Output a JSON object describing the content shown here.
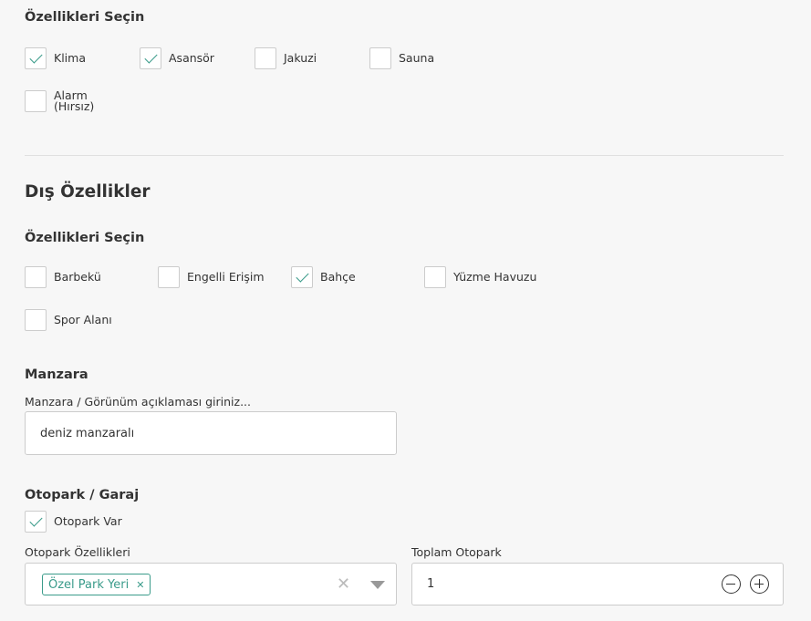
{
  "interior": {
    "section_title": "Özellikleri Seçin",
    "options": [
      {
        "label": "Klima",
        "checked": true
      },
      {
        "label": "Asansör",
        "checked": true
      },
      {
        "label": "Jakuzi",
        "checked": false
      },
      {
        "label": "Sauna",
        "checked": false
      },
      {
        "label_line1": "Alarm",
        "label_line2": "(Hırsız)",
        "checked": false
      }
    ]
  },
  "exterior": {
    "title": "Dış Özellikler",
    "section_title": "Özellikleri Seçin",
    "options": [
      {
        "label": "Barbekü",
        "checked": false
      },
      {
        "label": "Engelli Erişim",
        "checked": false
      },
      {
        "label": "Bahçe",
        "checked": true
      },
      {
        "label": "Yüzme Havuzu",
        "checked": false
      },
      {
        "label": "Spor Alanı",
        "checked": false
      }
    ]
  },
  "view": {
    "title": "Manzara",
    "field_label": "Manzara / Görünüm açıklaması giriniz...",
    "value": "deniz manzaralı"
  },
  "parking": {
    "title": "Otopark / Garaj",
    "has_parking_label": "Otopark Var",
    "has_parking_checked": true,
    "features_label": "Otopark Özellikleri",
    "selected_tags": [
      "Özel Park Yeri"
    ],
    "total_label": "Toplam Otopark",
    "total_value": "1"
  },
  "colors": {
    "accent": "#3a9b8a",
    "background": "#f7f7f7",
    "border": "#cccccc"
  },
  "icons": {
    "check": "check-icon",
    "tag_remove": "close-icon",
    "clear": "clear-icon",
    "dropdown": "chevron-down-icon",
    "decrement": "minus-circle-icon",
    "increment": "plus-circle-icon"
  }
}
